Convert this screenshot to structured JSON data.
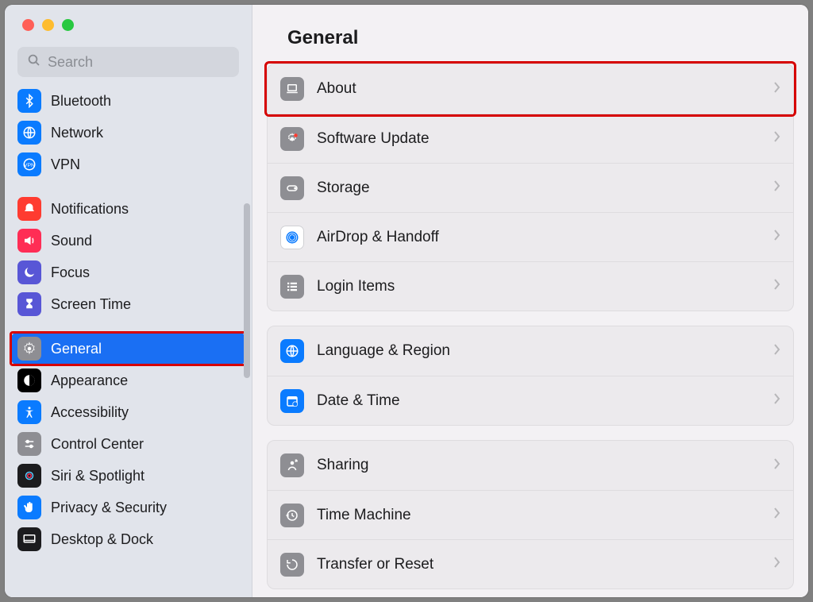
{
  "window": {
    "title": "General"
  },
  "search": {
    "placeholder": "Search"
  },
  "sidebar": {
    "items": [
      {
        "label": "Bluetooth",
        "icon": "bluetooth-icon",
        "color": "#0a7bff"
      },
      {
        "label": "Network",
        "icon": "globe-icon",
        "color": "#0a7bff"
      },
      {
        "label": "VPN",
        "icon": "vpn-icon",
        "color": "#0a7bff"
      },
      {
        "label": "Notifications",
        "icon": "bell-icon",
        "color": "#ff3b30"
      },
      {
        "label": "Sound",
        "icon": "speaker-icon",
        "color": "#ff2d55"
      },
      {
        "label": "Focus",
        "icon": "moon-icon",
        "color": "#5856d6"
      },
      {
        "label": "Screen Time",
        "icon": "hourglass-icon",
        "color": "#5856d6"
      },
      {
        "label": "General",
        "icon": "gear-gray-icon",
        "color": "#8e8e93",
        "selected": true
      },
      {
        "label": "Appearance",
        "icon": "appearance-icon",
        "color": "#000000"
      },
      {
        "label": "Accessibility",
        "icon": "accessibility-icon",
        "color": "#0a7bff"
      },
      {
        "label": "Control Center",
        "icon": "sliders-icon",
        "color": "#8e8e93"
      },
      {
        "label": "Siri & Spotlight",
        "icon": "siri-icon",
        "color": "#1c1c1e"
      },
      {
        "label": "Privacy & Security",
        "icon": "hand-icon",
        "color": "#0a7bff"
      },
      {
        "label": "Desktop & Dock",
        "icon": "dock-icon",
        "color": "#1c1c1e"
      }
    ]
  },
  "main": {
    "title": "General",
    "groups": [
      [
        {
          "label": "About",
          "icon": "laptop-icon",
          "color": "#8e8e93",
          "highlight": true
        },
        {
          "label": "Software Update",
          "icon": "gear-badge-icon",
          "color": "#8e8e93"
        },
        {
          "label": "Storage",
          "icon": "disk-icon",
          "color": "#8e8e93"
        },
        {
          "label": "AirDrop & Handoff",
          "icon": "airdrop-icon",
          "color": "#0a7bff"
        },
        {
          "label": "Login Items",
          "icon": "list-icon",
          "color": "#8e8e93"
        }
      ],
      [
        {
          "label": "Language & Region",
          "icon": "globe-icon",
          "color": "#0a7bff"
        },
        {
          "label": "Date & Time",
          "icon": "calendar-icon",
          "color": "#0a7bff"
        }
      ],
      [
        {
          "label": "Sharing",
          "icon": "sharing-icon",
          "color": "#8e8e93"
        },
        {
          "label": "Time Machine",
          "icon": "timemachine-icon",
          "color": "#8e8e93"
        },
        {
          "label": "Transfer or Reset",
          "icon": "reset-icon",
          "color": "#8e8e93"
        }
      ]
    ]
  },
  "highlights": {
    "sidebar_general": true,
    "about_row": true
  }
}
